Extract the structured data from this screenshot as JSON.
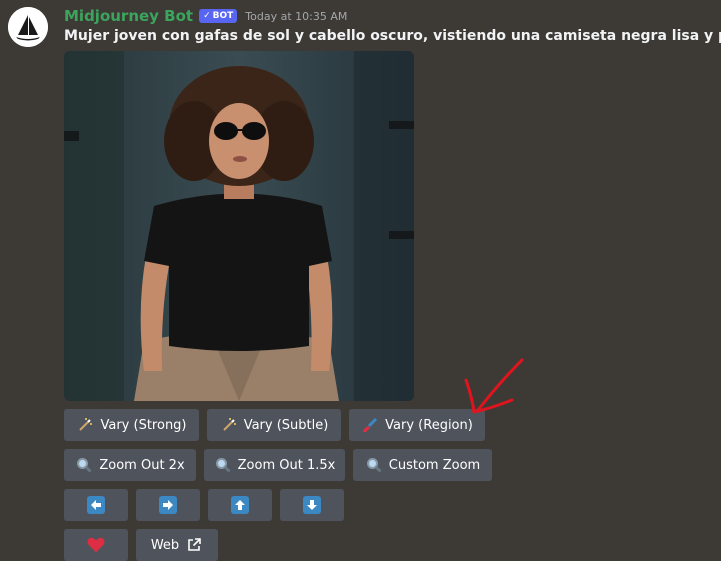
{
  "message": {
    "username": "Midjourney Bot",
    "bot_tag": "BOT",
    "verified_mark": "✓",
    "timestamp": "Today at 10:35 AM",
    "prompt": "Mujer joven con gafas de sol y cabello oscuro, vistiendo una camiseta negra lisa y pantalones t"
  },
  "buttons": {
    "row1": [
      {
        "label": "Vary (Strong)",
        "icon": "magic-wand-icon"
      },
      {
        "label": "Vary (Subtle)",
        "icon": "magic-wand-icon"
      },
      {
        "label": "Vary (Region)",
        "icon": "paintbrush-icon"
      }
    ],
    "row2": [
      {
        "label": "Zoom Out 2x",
        "icon": "magnifier-icon"
      },
      {
        "label": "Zoom Out 1.5x",
        "icon": "magnifier-icon"
      },
      {
        "label": "Custom Zoom",
        "icon": "magnifier-icon"
      }
    ],
    "row3": [
      {
        "icon": "arrow-left-icon"
      },
      {
        "icon": "arrow-right-icon"
      },
      {
        "icon": "arrow-up-icon"
      },
      {
        "icon": "arrow-down-icon"
      }
    ],
    "row4": [
      {
        "icon": "heart-icon"
      },
      {
        "label": "Web",
        "icon": "external-link-icon"
      }
    ]
  },
  "colors": {
    "background": "#3d3a36",
    "username": "#3ba55d",
    "bot_tag": "#5865f2",
    "button": "#4f545c",
    "arrow_box": "#3b88c3",
    "heart": "#dd2e44",
    "annotation_arrow": "#e0141e"
  }
}
